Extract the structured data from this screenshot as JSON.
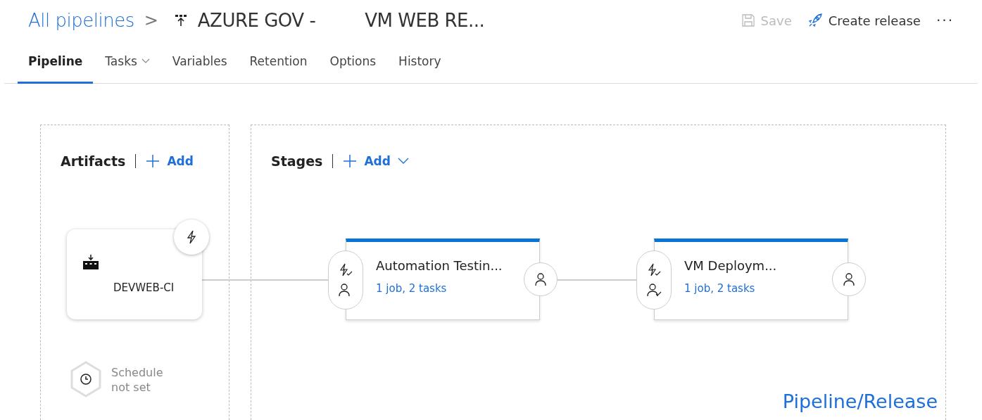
{
  "breadcrumb": {
    "root": "All pipelines",
    "separator": ">",
    "title_part_1": "AZURE GOV -",
    "title_part_2": "VM WEB RE..."
  },
  "toolbar": [
    {
      "label": "Save",
      "kind": "save",
      "disabled": true
    },
    {
      "label": "Create release",
      "kind": "release",
      "disabled": false
    },
    {
      "label": "···",
      "kind": "more",
      "disabled": false
    }
  ],
  "tabs": [
    {
      "label": "Pipeline",
      "selected": true,
      "dropdown": false
    },
    {
      "label": "Tasks",
      "selected": false,
      "dropdown": true
    },
    {
      "label": "Variables",
      "selected": false,
      "dropdown": false
    },
    {
      "label": "Retention",
      "selected": false,
      "dropdown": false
    },
    {
      "label": "Options",
      "selected": false,
      "dropdown": false
    },
    {
      "label": "History",
      "selected": false,
      "dropdown": false
    }
  ],
  "artifacts": {
    "heading": "Artifacts",
    "add_label": "Add",
    "artifact": {
      "name": "DEVWEB-CI"
    },
    "schedule": "Schedule not set"
  },
  "stages": {
    "heading": "Stages",
    "add_label": "Add",
    "items": [
      {
        "name": "Automation Testin...",
        "summary": "1 job, 2 tasks",
        "pre_approval_set": false
      },
      {
        "name": "VM Deploym...",
        "summary": "1 job, 2 tasks",
        "pre_approval_set": true
      }
    ]
  },
  "caption": "Pipeline/Release"
}
